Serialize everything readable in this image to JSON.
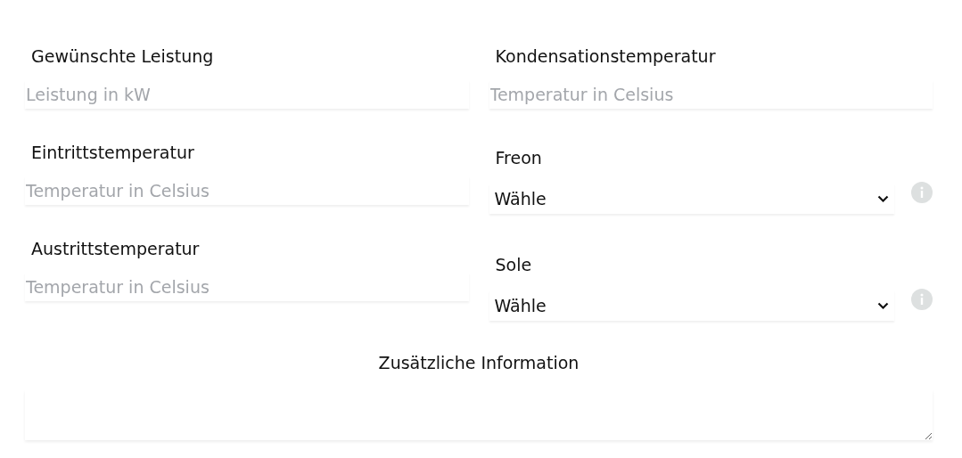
{
  "left": [
    {
      "kind": "input",
      "label": "Gewünschte Leistung",
      "placeholder": "Leistung in kW"
    },
    {
      "kind": "input",
      "label": "Eintrittstemperatur",
      "placeholder": "Temperatur in Celsius"
    },
    {
      "kind": "input",
      "label": "Austrittstemperatur",
      "placeholder": "Temperatur in Celsius"
    }
  ],
  "right": [
    {
      "kind": "input",
      "label": "Kondensationstemperatur",
      "placeholder": "Temperatur in Celsius"
    },
    {
      "kind": "select",
      "label": "Freon",
      "value": "Wähle"
    },
    {
      "kind": "select",
      "label": "Sole",
      "value": "Wähle"
    }
  ],
  "notes": {
    "label": "Zusätzliche Information"
  }
}
